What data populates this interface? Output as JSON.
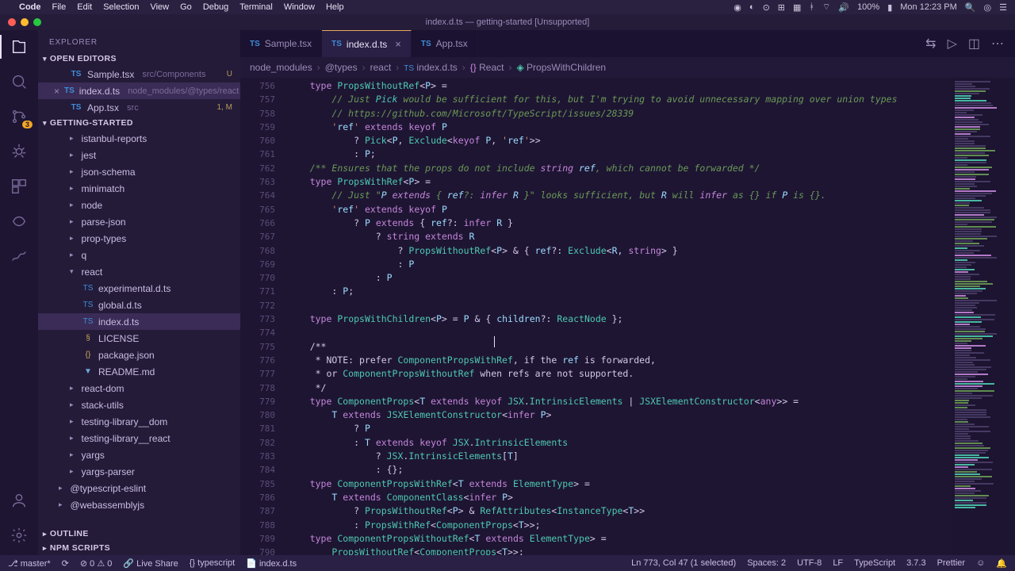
{
  "mac": {
    "app": "Code",
    "menus": [
      "File",
      "Edit",
      "Selection",
      "View",
      "Go",
      "Debug",
      "Terminal",
      "Window",
      "Help"
    ],
    "clock": "Mon 12:23 PM",
    "battery": "100%"
  },
  "title": "index.d.ts — getting-started [Unsupported]",
  "activity_badge": "3",
  "sidebar": {
    "title": "EXPLORER",
    "open_editors_label": "OPEN EDITORS",
    "open_editors": [
      {
        "name": "Sample.tsx",
        "path": "src/Components",
        "status": "U"
      },
      {
        "name": "index.d.ts",
        "path": "node_modules/@types/react",
        "status": ""
      },
      {
        "name": "App.tsx",
        "path": "src",
        "status": "1, M"
      }
    ],
    "project_label": "GETTING-STARTED",
    "tree": [
      {
        "name": "istanbul-reports",
        "type": "folder",
        "depth": 1
      },
      {
        "name": "jest",
        "type": "folder",
        "depth": 1
      },
      {
        "name": "json-schema",
        "type": "folder",
        "depth": 1
      },
      {
        "name": "minimatch",
        "type": "folder",
        "depth": 1
      },
      {
        "name": "node",
        "type": "folder",
        "depth": 1
      },
      {
        "name": "parse-json",
        "type": "folder",
        "depth": 1
      },
      {
        "name": "prop-types",
        "type": "folder",
        "depth": 1
      },
      {
        "name": "q",
        "type": "folder",
        "depth": 1
      },
      {
        "name": "react",
        "type": "folder",
        "depth": 1,
        "open": true
      },
      {
        "name": "experimental.d.ts",
        "type": "file",
        "depth": 2,
        "ico": "ts"
      },
      {
        "name": "global.d.ts",
        "type": "file",
        "depth": 2,
        "ico": "ts"
      },
      {
        "name": "index.d.ts",
        "type": "file",
        "depth": 2,
        "ico": "ts",
        "active": true
      },
      {
        "name": "LICENSE",
        "type": "file",
        "depth": 2,
        "ico": "lic"
      },
      {
        "name": "package.json",
        "type": "file",
        "depth": 2,
        "ico": "json"
      },
      {
        "name": "README.md",
        "type": "file",
        "depth": 2,
        "ico": "md"
      },
      {
        "name": "react-dom",
        "type": "folder",
        "depth": 1
      },
      {
        "name": "stack-utils",
        "type": "folder",
        "depth": 1
      },
      {
        "name": "testing-library__dom",
        "type": "folder",
        "depth": 1
      },
      {
        "name": "testing-library__react",
        "type": "folder",
        "depth": 1
      },
      {
        "name": "yargs",
        "type": "folder",
        "depth": 1
      },
      {
        "name": "yargs-parser",
        "type": "folder",
        "depth": 1
      },
      {
        "name": "@typescript-eslint",
        "type": "folder",
        "depth": 0
      },
      {
        "name": "@webassemblyjs",
        "type": "folder",
        "depth": 0
      }
    ],
    "outline_label": "OUTLINE",
    "npm_label": "NPM SCRIPTS"
  },
  "tabs": [
    {
      "name": "Sample.tsx"
    },
    {
      "name": "index.d.ts",
      "active": true
    },
    {
      "name": "App.tsx"
    }
  ],
  "breadcrumb": [
    "node_modules",
    "@types",
    "react",
    "index.d.ts",
    "React",
    "PropsWithChildren"
  ],
  "editor": {
    "first_line": 756,
    "lines": [
      "    type PropsWithoutRef<P> =",
      "        // Just Pick would be sufficient for this, but I'm trying to avoid unnecessary mapping over union types",
      "        // https://github.com/Microsoft/TypeScript/issues/28339",
      "        'ref' extends keyof P",
      "            ? Pick<P, Exclude<keyof P, 'ref'>>",
      "            : P;",
      "    /** Ensures that the props do not include string ref, which cannot be forwarded */",
      "    type PropsWithRef<P> =",
      "        // Just \"P extends { ref?: infer R }\" looks sufficient, but R will infer as {} if P is {}.",
      "        'ref' extends keyof P",
      "            ? P extends { ref?: infer R }",
      "                ? string extends R",
      "                    ? PropsWithoutRef<P> & { ref?: Exclude<R, string> }",
      "                    : P",
      "                : P",
      "        : P;",
      "",
      "    type PropsWithChildren<P> = P & { children?: ReactNode };",
      "",
      "    /**",
      "     * NOTE: prefer ComponentPropsWithRef, if the ref is forwarded,",
      "     * or ComponentPropsWithoutRef when refs are not supported.",
      "     */",
      "    type ComponentProps<T extends keyof JSX.IntrinsicElements | JSXElementConstructor<any>> =",
      "        T extends JSXElementConstructor<infer P>",
      "            ? P",
      "            : T extends keyof JSX.IntrinsicElements",
      "                ? JSX.IntrinsicElements[T]",
      "                : {};",
      "    type ComponentPropsWithRef<T extends ElementType> =",
      "        T extends ComponentClass<infer P>",
      "            ? PropsWithoutRef<P> & RefAttributes<InstanceType<T>>",
      "            : PropsWithRef<ComponentProps<T>>;",
      "    type ComponentPropsWithoutRef<T extends ElementType> =",
      "        PropsWithoutRef<ComponentProps<T>>;"
    ]
  },
  "status": {
    "branch": "master*",
    "errors": "0",
    "warnings": "0",
    "liveshare": "Live Share",
    "lang_server": "typescript",
    "file": "index.d.ts",
    "cursor": "Ln 773, Col 47 (1 selected)",
    "spaces": "Spaces: 2",
    "encoding": "UTF-8",
    "eol": "LF",
    "language": "TypeScript",
    "version": "3.7.3",
    "prettier": "Prettier",
    "feedback": "☺",
    "bell": "🔔"
  }
}
